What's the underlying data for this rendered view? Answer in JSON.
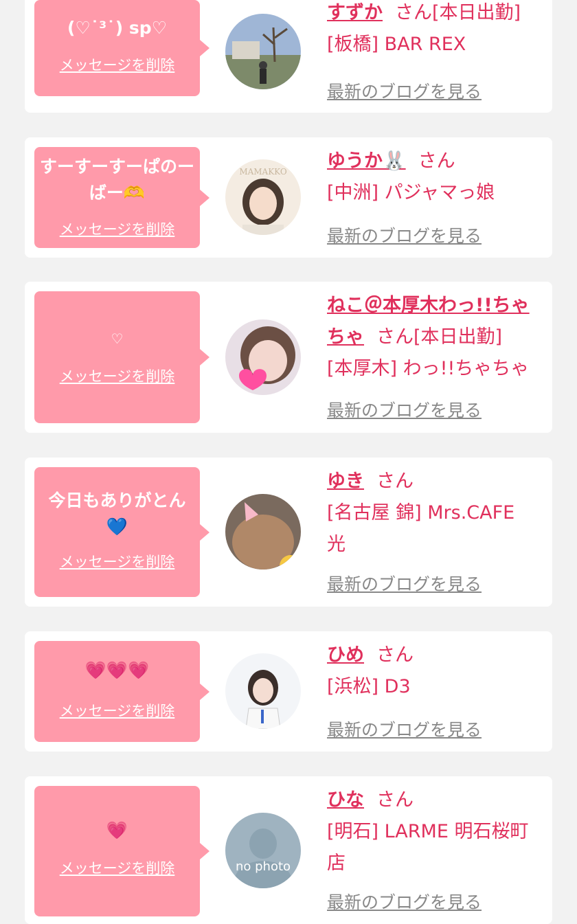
{
  "common": {
    "delete_label": "メッセージを削除",
    "blog_label": "最新のブログを見る",
    "honorific": "さん"
  },
  "cards": [
    {
      "message": "(♡˙³˙) sp♡",
      "name": "すずか",
      "status": "[本日出勤]",
      "shop": "[板橋] BAR REX"
    },
    {
      "message": "すーすーすーぱのーばー🫶",
      "name": "ゆうか🐰",
      "status": "",
      "shop": "[中洲] パジャマっ娘"
    },
    {
      "message": "♡",
      "name_line1": "ねこ＠本厚木わっ!!ちゃ",
      "name_line2": "ちゃ",
      "status": "[本日出勤]",
      "shop": "[本厚木] わっ!!ちゃちゃ"
    },
    {
      "message": "今日もありがとん💙",
      "name": "ゆき",
      "status": "",
      "shop_line1": "[名古屋 錦] Mrs.CAFE",
      "shop_line2": "光"
    },
    {
      "message": "💗💗💗",
      "name": "ひめ",
      "status": "",
      "shop": "[浜松] D3"
    },
    {
      "message": "💗",
      "name": "ひな",
      "status": "",
      "shop_line1": "[明石] LARME 明石桜町",
      "shop_line2": "店",
      "avatar_text": "no photo"
    }
  ],
  "colors": {
    "bubble": "#ff9aaa",
    "accent": "#e0305c",
    "link_gray": "#888888",
    "background": "#f2f2f2"
  }
}
